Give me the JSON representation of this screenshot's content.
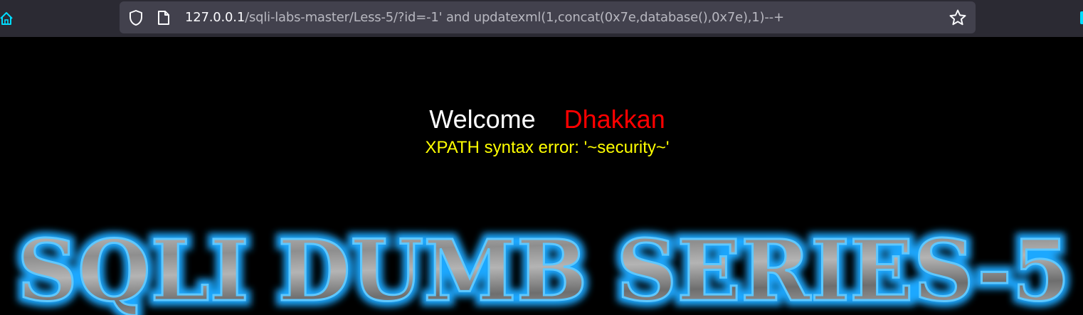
{
  "browser": {
    "url_host": "127.0.0.1",
    "url_path": "/sqli-labs-master/Less-5/?id=-1' and updatexml(1,concat(0x7e,database(),0x7e),1)--+",
    "icons": [
      "home-icon",
      "shield-icon",
      "page-icon",
      "star-icon"
    ],
    "accent_color": "#00ddff"
  },
  "page": {
    "welcome": "Welcome",
    "name": "Dhakkan",
    "error_message": "XPATH syntax error: '~security~'",
    "banner_text": "SQLI DUMB SERIES-5",
    "colors": {
      "background": "#000000",
      "welcome": "#ffffff",
      "name": "#ff0000",
      "error": "#ffff00",
      "banner_glow": "#1ea8ff"
    }
  }
}
